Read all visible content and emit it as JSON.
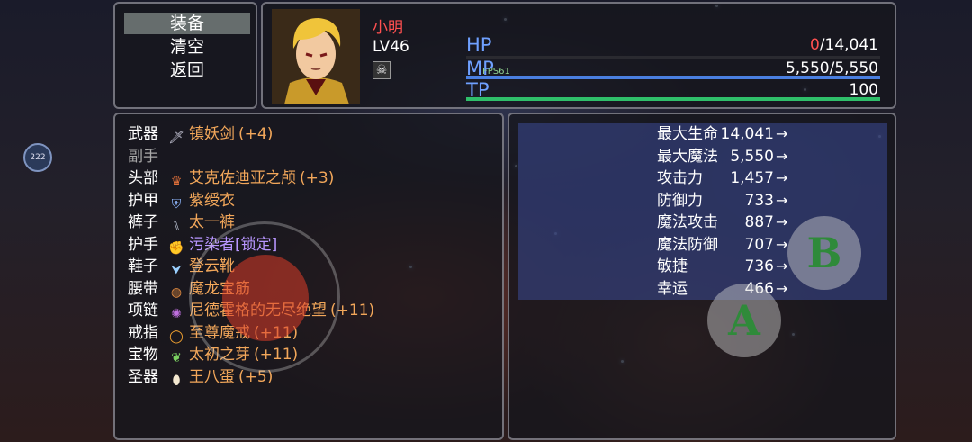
{
  "command": {
    "items": [
      "装备",
      "清空",
      "返回"
    ],
    "selected": 0
  },
  "actor": {
    "name": "小明",
    "level": "LV46",
    "state_icon": "skull-icon",
    "gauges": [
      {
        "label": "HP",
        "current": "0",
        "value_rest": "/14,041",
        "fill": 0.0,
        "color": "#c84040"
      },
      {
        "label": "MP",
        "current": "",
        "value_rest": "5,550/5,550",
        "fill": 1.0,
        "color": "#4a7fe0"
      },
      {
        "label": "TP",
        "current": "",
        "value_rest": "100",
        "fill": 1.0,
        "color": "#2fbf6a"
      }
    ],
    "fps": "FPS61"
  },
  "equipment": [
    {
      "slot": "武器",
      "icon": "sword-icon",
      "item": "镇妖剑",
      "bonus": "(+4)",
      "locked": false,
      "empty": false
    },
    {
      "slot": "副手",
      "icon": "",
      "item": "",
      "bonus": "",
      "locked": false,
      "empty": true
    },
    {
      "slot": "头部",
      "icon": "crown-icon",
      "item": "艾克佐迪亚之颅",
      "bonus": "(+3)",
      "locked": false,
      "empty": false
    },
    {
      "slot": "护甲",
      "icon": "armor-icon",
      "item": "紫绶衣",
      "bonus": "",
      "locked": false,
      "empty": false
    },
    {
      "slot": "裤子",
      "icon": "pants-icon",
      "item": "太一裤",
      "bonus": "",
      "locked": false,
      "empty": false
    },
    {
      "slot": "护手",
      "icon": "gauntlet-icon",
      "item": "污染者[锁定]",
      "bonus": "",
      "locked": true,
      "empty": false
    },
    {
      "slot": "鞋子",
      "icon": "boots-icon",
      "item": "登云靴",
      "bonus": "",
      "locked": false,
      "empty": false
    },
    {
      "slot": "腰带",
      "icon": "belt-icon",
      "item": "魔龙宝筋",
      "bonus": "",
      "locked": false,
      "empty": false
    },
    {
      "slot": "项链",
      "icon": "necklace-icon",
      "item": "尼德霍格的无尽绝望",
      "bonus": "(+11)",
      "locked": false,
      "empty": false
    },
    {
      "slot": "戒指",
      "icon": "ring-icon",
      "item": "至尊魔戒",
      "bonus": "(+11)",
      "locked": false,
      "empty": false
    },
    {
      "slot": "宝物",
      "icon": "sprout-icon",
      "item": "太初之芽",
      "bonus": "(+11)",
      "locked": false,
      "empty": false
    },
    {
      "slot": "圣器",
      "icon": "egg-icon",
      "item": "王八蛋",
      "bonus": "(+5)",
      "locked": false,
      "empty": false
    }
  ],
  "params": [
    {
      "name": "最大生命",
      "value": "14,041"
    },
    {
      "name": "最大魔法",
      "value": "5,550"
    },
    {
      "name": "攻击力",
      "value": "1,457"
    },
    {
      "name": "防御力",
      "value": "733"
    },
    {
      "name": "魔法攻击",
      "value": "887"
    },
    {
      "name": "魔法防御",
      "value": "707"
    },
    {
      "name": "敏捷",
      "value": "736"
    },
    {
      "name": "幸运",
      "value": "466"
    }
  ],
  "param_arrow": "→",
  "overlay": {
    "badge": "222",
    "button_a": "A",
    "button_b": "B"
  }
}
